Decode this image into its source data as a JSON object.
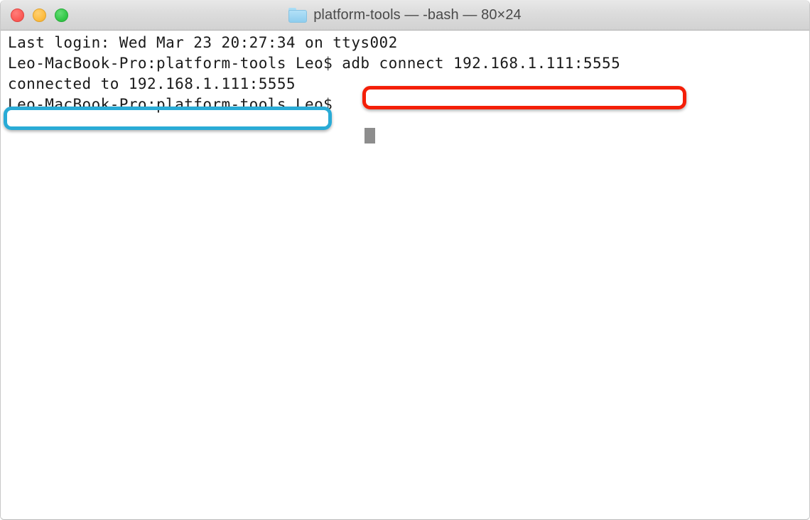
{
  "window": {
    "title": "platform-tools — -bash — 80×24",
    "folder_icon": "folder-icon",
    "controls": {
      "close_label": "close",
      "minimize_label": "minimize",
      "zoom_label": "zoom"
    }
  },
  "terminal": {
    "lines": {
      "last_login": "Last login: Wed Mar 23 20:27:34 on ttys002",
      "prompt_1": "Leo-MacBook-Pro:platform-tools Leo$ adb connect 192.168.1.111:5555",
      "output": "connected to 192.168.1.111:5555",
      "prompt_2": "Leo-MacBook-Pro:platform-tools Leo$ "
    },
    "prompt_text": "Leo-MacBook-Pro:platform-tools Leo$",
    "command": "adb connect 192.168.1.111:5555",
    "output_text": "connected to 192.168.1.111:5555",
    "host": "Leo-MacBook-Pro",
    "directory": "platform-tools",
    "user": "Leo",
    "tty": "ttys002",
    "login_time": "Wed Mar 23 20:27:34",
    "ip_port": "192.168.1.111:5555",
    "cursor": "block-cursor"
  },
  "annotations": {
    "command_box": {
      "label": "adb connect 192.168.1.111:5555",
      "color": "#f41f08"
    },
    "output_box": {
      "label": "connected to 192.168.1.111:5555",
      "color": "#29abd6"
    }
  },
  "colors": {
    "titlebar_top": "#e8e8e8",
    "titlebar_bottom": "#d2d2d2",
    "terminal_bg": "#ffffff",
    "terminal_fg": "#1a1a1a",
    "close": "#fc5b57",
    "minimize": "#fdbc40",
    "zoom": "#33c748",
    "cursor": "#8d8d8d",
    "folder": "#8ecdee",
    "red_annotation": "#f41f08",
    "cyan_annotation": "#29abd6"
  }
}
